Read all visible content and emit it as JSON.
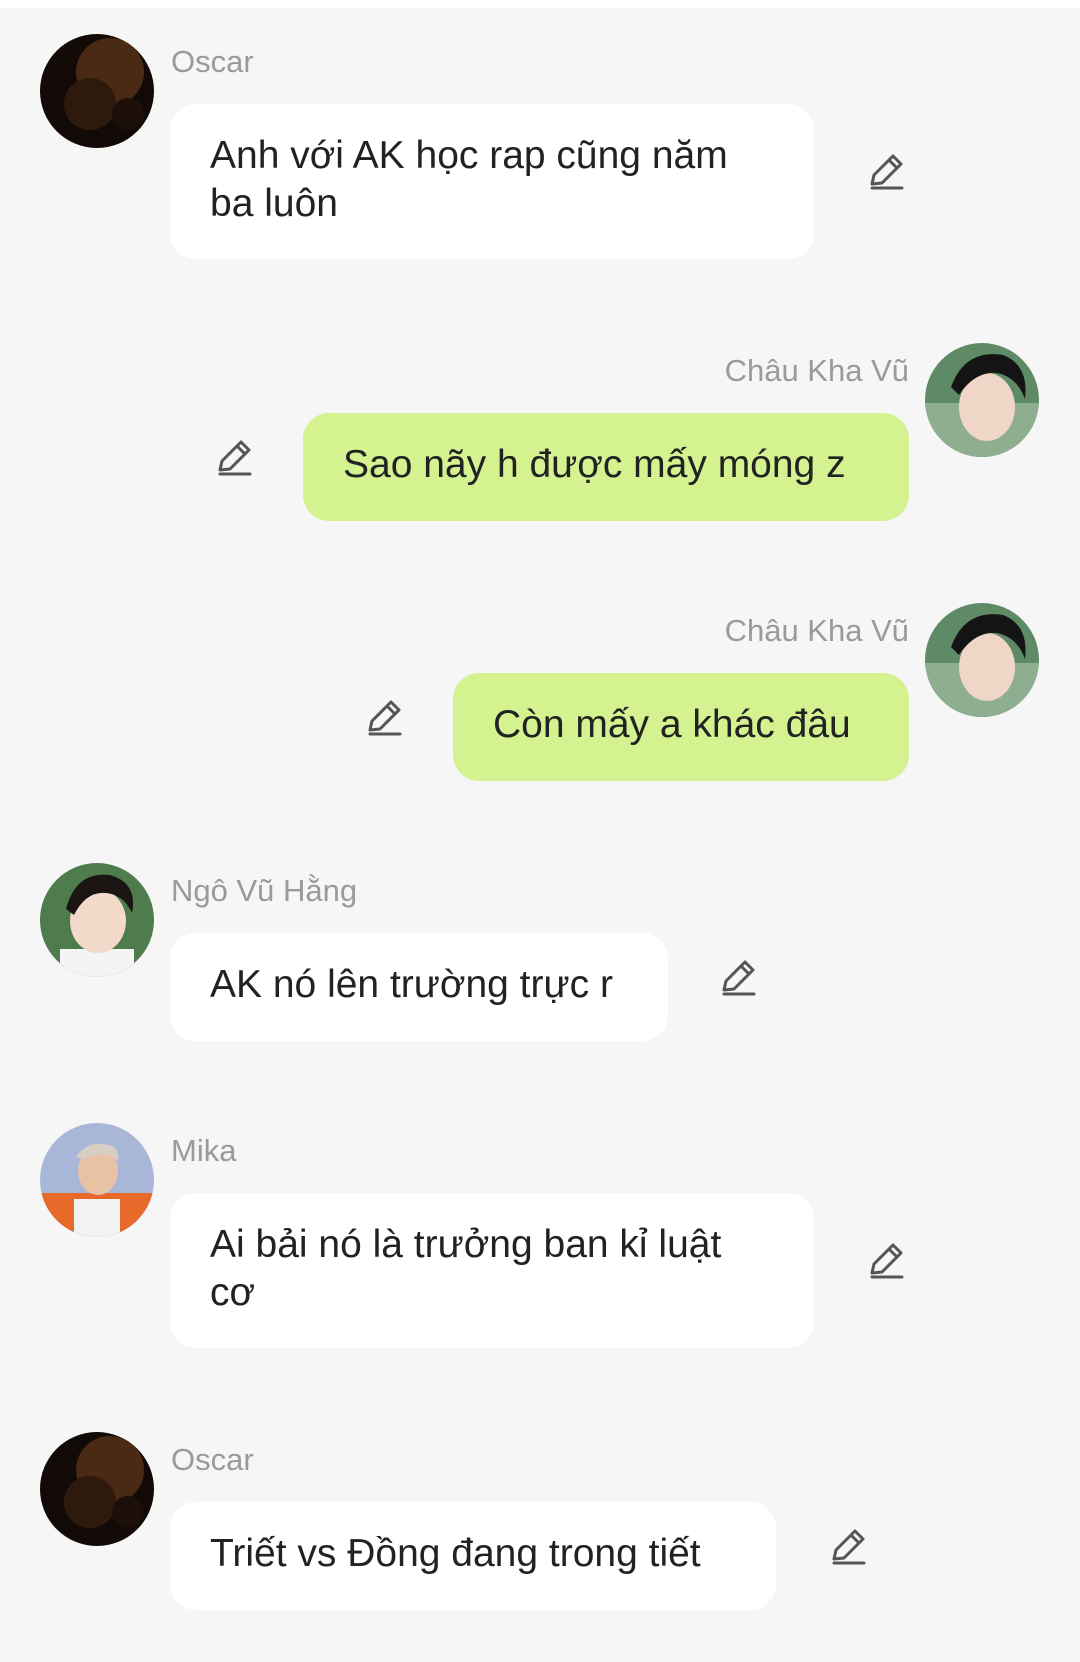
{
  "messages": [
    {
      "sender": "Oscar",
      "text": "Anh với AK học rap cũng năm ba luôn",
      "direction": "incoming"
    },
    {
      "sender": "Châu Kha Vũ",
      "text": "Sao nãy h được mấy móng z",
      "direction": "outgoing"
    },
    {
      "sender": "Châu Kha Vũ",
      "text": "Còn mấy a khác đâu",
      "direction": "outgoing"
    },
    {
      "sender": "Ngô Vũ Hằng",
      "text": "AK nó lên trường trực r",
      "direction": "incoming"
    },
    {
      "sender": "Mika",
      "text": "Ai bải nó là trưởng ban kỉ luật cơ",
      "direction": "incoming"
    },
    {
      "sender": "Oscar",
      "text": "Triết vs Đồng đang trong tiết",
      "direction": "incoming"
    }
  ],
  "icons": {
    "edit": "pencil-edit-icon",
    "avatar": "avatar-photo"
  },
  "colors": {
    "background": "#f6f6f6",
    "incoming_bubble": "#ffffff",
    "outgoing_bubble": "#d4f28f",
    "sender_name": "#9a9a9a",
    "message_text": "#222222",
    "icon": "#555555"
  }
}
